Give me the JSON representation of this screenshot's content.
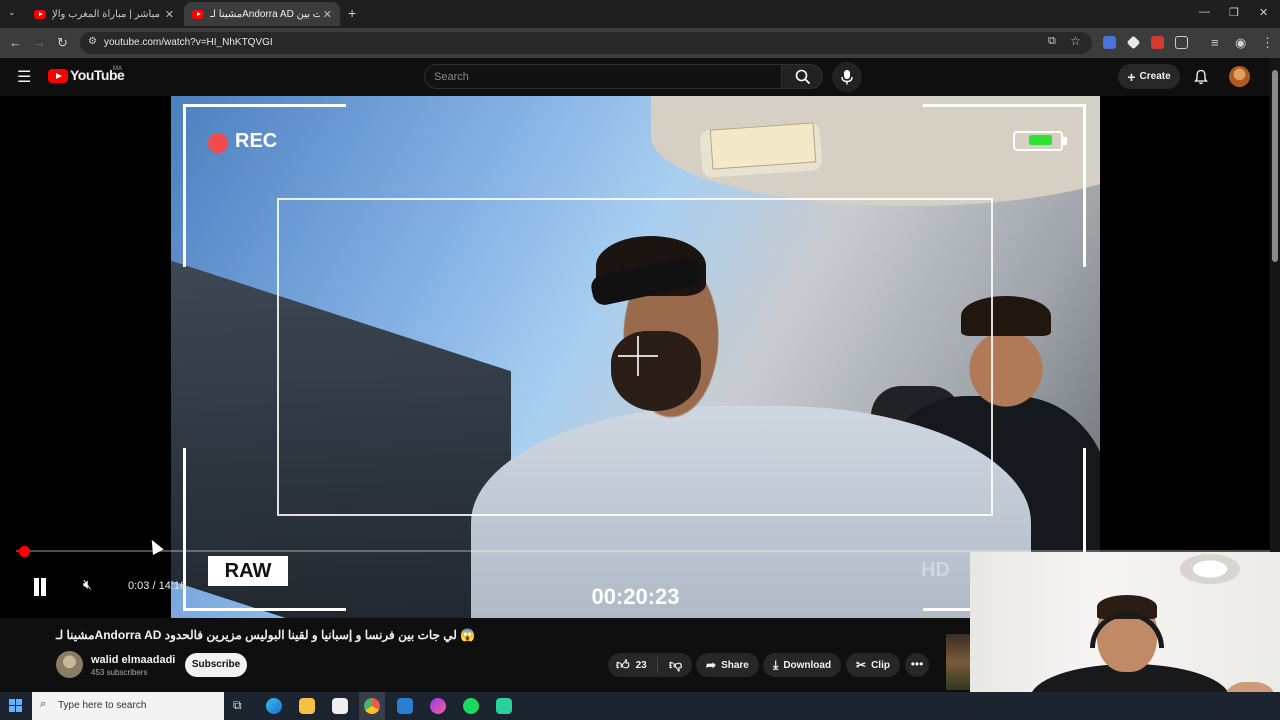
{
  "browser": {
    "tabs": [
      {
        "title": "بث مباشر | مباراة المغرب والإ",
        "active": false
      },
      {
        "title": "مشينا لـAndorra AD لي جات بين",
        "active": true
      }
    ],
    "new_tab_icon": "plus-icon",
    "url": "youtube.com/watch?v=HI_NhKTQVGI"
  },
  "youtube": {
    "logo_text": "YouTube",
    "country_code": "MA",
    "search_placeholder": "Search",
    "create_label": "Create"
  },
  "video": {
    "overlay": {
      "rec_label": "REC",
      "raw_label": "RAW",
      "timecode": "00:20:23",
      "hd_label": "HD",
      "battery_level": 0.55
    },
    "progress": 0.0035,
    "current_time": "0:03",
    "separator": " / ",
    "duration": "14:16",
    "title": "مشينا لـAndorra AD لي جات بين فرنسا و إسبانيا و لقينا البوليس مزيرين فالحدود 😱"
  },
  "channel": {
    "name": "walid elmaadadi",
    "subscribers": "453 subscribers",
    "subscribe_label": "Subscribe"
  },
  "actions": {
    "like_count": "23",
    "share_label": "Share",
    "download_label": "Download",
    "clip_label": "Clip",
    "more_label": "•••"
  },
  "taskbar": {
    "search_placeholder": "Type here to search",
    "apps": [
      "task-view-icon",
      "edge-icon",
      "file-explorer-icon",
      "store-icon",
      "chrome-icon",
      "mail-icon",
      "messenger-icon",
      "spotify-icon",
      "app-icon"
    ]
  },
  "colors": {
    "youtube_red": "#ff0000",
    "rec_red": "#f24b4b",
    "battery_green": "#31e331",
    "page_bg": "#0f0f0f"
  }
}
